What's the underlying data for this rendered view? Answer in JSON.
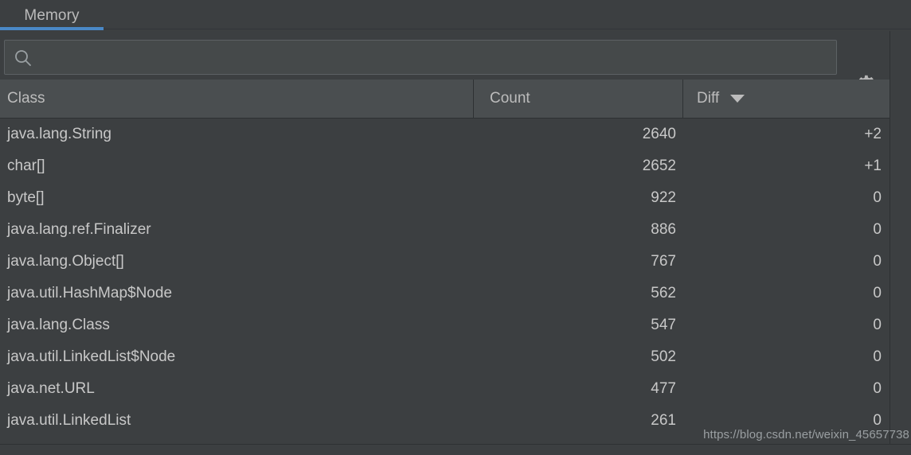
{
  "window": {
    "theme_background": "#3c3f41",
    "accent_color": "#4a88c7"
  },
  "tabs": [
    {
      "label": "Memory",
      "active": true
    }
  ],
  "search": {
    "value": "",
    "placeholder": "",
    "icon": "search-icon"
  },
  "toolbar": {
    "settings_icon": "gear-icon",
    "settings_tooltip": ""
  },
  "table": {
    "columns": [
      {
        "key": "class",
        "label": "Class",
        "sorted": false
      },
      {
        "key": "count",
        "label": "Count",
        "sorted": false
      },
      {
        "key": "diff",
        "label": "Diff",
        "sorted": true,
        "sort_direction": "desc"
      }
    ],
    "rows": [
      {
        "class": "java.lang.String",
        "count": "2640",
        "diff": "+2"
      },
      {
        "class": "char[]",
        "count": "2652",
        "diff": "+1"
      },
      {
        "class": "byte[]",
        "count": "922",
        "diff": "0"
      },
      {
        "class": "java.lang.ref.Finalizer",
        "count": "886",
        "diff": "0"
      },
      {
        "class": "java.lang.Object[]",
        "count": "767",
        "diff": "0"
      },
      {
        "class": "java.util.HashMap$Node",
        "count": "562",
        "diff": "0"
      },
      {
        "class": "java.lang.Class",
        "count": "547",
        "diff": "0"
      },
      {
        "class": "java.util.LinkedList$Node",
        "count": "502",
        "diff": "0"
      },
      {
        "class": "java.net.URL",
        "count": "477",
        "diff": "0"
      },
      {
        "class": "java.util.LinkedList",
        "count": "261",
        "diff": "0"
      }
    ]
  },
  "scrollbar": {
    "orientation": "vertical",
    "thumb_position_percent": 26,
    "thumb_size_percent": 11
  },
  "watermark": {
    "text": "https://blog.csdn.net/weixin_45657738"
  }
}
